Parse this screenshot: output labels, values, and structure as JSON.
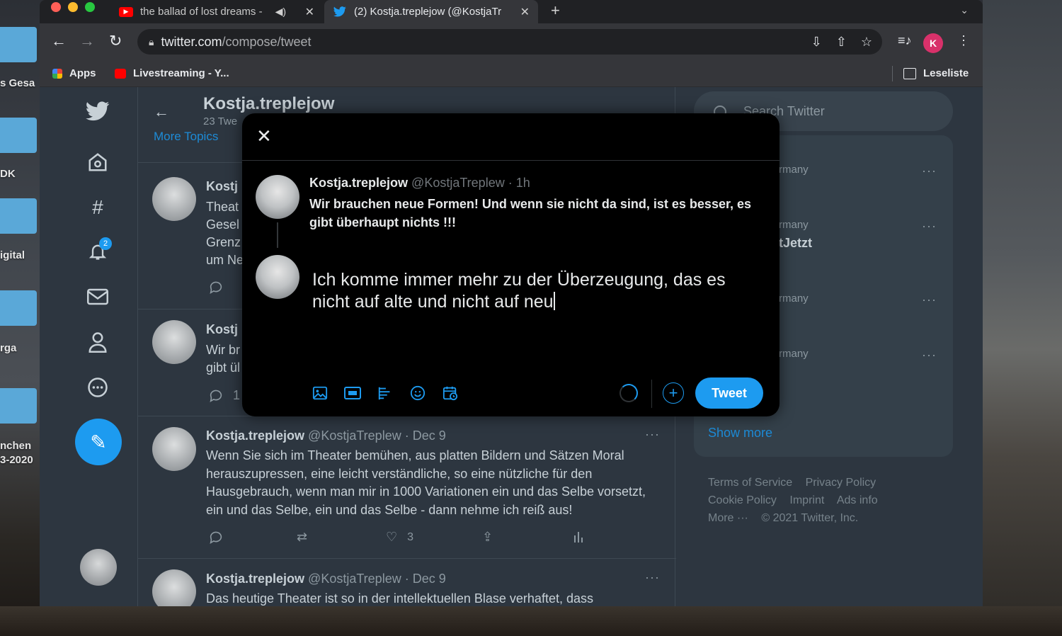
{
  "desktop": {
    "labels": [
      "s Gesa",
      "DK",
      "igital",
      "rga",
      "nchen",
      "3-2020"
    ]
  },
  "browser": {
    "tabs": [
      {
        "title": "the ballad of lost dreams -",
        "icon": "youtube-icon",
        "audio": true
      },
      {
        "title": "(2) Kostja.treplejow (@KostjaTr",
        "icon": "twitter-icon",
        "active": true
      }
    ],
    "url_host": "twitter.com",
    "url_path": "/compose/tweet",
    "profile_initial": "K",
    "bookmarks": [
      {
        "label": "Apps",
        "icon": "apps-grid-icon"
      },
      {
        "label": "Livestreaming - Y...",
        "icon": "youtube-icon"
      }
    ],
    "reading_list": "Leseliste"
  },
  "twitter": {
    "notifications_count": "2",
    "header": {
      "name": "Kostja.treplejow",
      "tweets_count": "23 Twe"
    },
    "more_topics": "More Topics",
    "partial_tweets": [
      {
        "name": "Kostj",
        "lines": [
          "Theat",
          "Gesel",
          "Grenz",
          "um Ne"
        ]
      },
      {
        "name": "Kostj",
        "lines": [
          "Wir br",
          "gibt ül"
        ],
        "reply_count": "1"
      }
    ],
    "tweets": [
      {
        "name": "Kostja.treplejow",
        "handle": "@KostjaTreplew",
        "date": "Dec 9",
        "text": "Wenn Sie sich im Theater bemühen, aus platten Bildern und Sätzen Moral herauszupressen, eine leicht verständliche, so eine nützliche für den Hausgebrauch, wenn man mir in 1000 Variationen ein und das Selbe vorsetzt, ein und das Selbe, ein und das Selbe - dann nehme ich reiß aus!",
        "likes": "3"
      },
      {
        "name": "Kostja.treplejow",
        "handle": "@KostjaTreplew",
        "date": "Dec 9",
        "text": "Das heutige Theater ist so in der intellektuellen Blase verhaftet, dass"
      }
    ],
    "search_placeholder": "Search Twitter",
    "trends": [
      {
        "sub": "rmany",
        "name": ""
      },
      {
        "sub": "rmany",
        "name": "tJetzt"
      },
      {
        "sub": "rmany",
        "name": ""
      },
      {
        "sub": "rmany",
        "name": ""
      }
    ],
    "show_more": "Show more",
    "footer": {
      "terms": "Terms of Service",
      "privacy": "Privacy Policy",
      "cookie": "Cookie Policy",
      "imprint": "Imprint",
      "ads": "Ads info",
      "more": "More ···",
      "copyright": "© 2021 Twitter, Inc."
    }
  },
  "modal": {
    "reply_to": {
      "name": "Kostja.treplejow",
      "handle": "@KostjaTreplew",
      "time": "· 1h",
      "text": "Wir brauchen neue Formen! Und wenn sie nicht da sind, ist es besser, es gibt überhaupt nichts !!!"
    },
    "draft_text": "Ich komme immer mehr zu der Überzeugung, das es nicht auf alte und nicht auf neu",
    "tweet_button": "Tweet",
    "tools": [
      "image-icon",
      "gif-icon",
      "poll-icon",
      "emoji-icon",
      "schedule-icon"
    ]
  }
}
